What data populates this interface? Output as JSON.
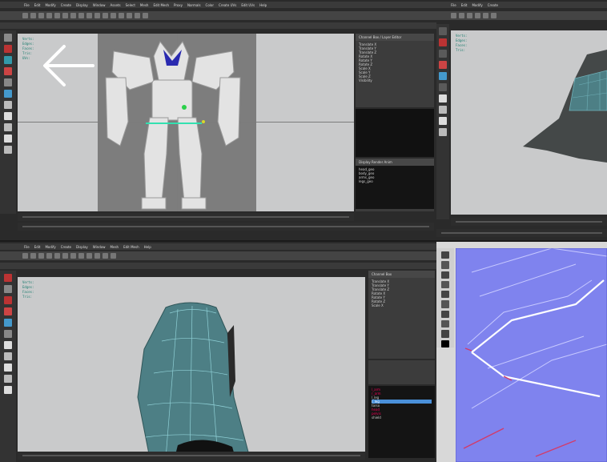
{
  "panes": {
    "top_left": {
      "menu": [
        "File",
        "Edit",
        "Modify",
        "Create",
        "Display",
        "Window",
        "Assets",
        "Select",
        "Mesh",
        "Edit Mesh",
        "Proxy",
        "Normals",
        "Color",
        "Create UVs",
        "Edit UVs",
        "Help"
      ],
      "hud": [
        "Verts:",
        "Edges:",
        "Faces:",
        "Tris:",
        "UVs:"
      ],
      "attr_title": "Channel Box / Layer Editor",
      "attr_rows": [
        "Translate X",
        "Translate Y",
        "Translate Z",
        "Rotate X",
        "Rotate Y",
        "Rotate Z",
        "Scale X",
        "Scale Y",
        "Scale Z",
        "Visibility"
      ],
      "layer_title": "Display   Render   Anim",
      "layer_rows": [
        "head_geo",
        "body_geo",
        "arms_geo",
        "legs_geo"
      ]
    },
    "top_right": {
      "menu": [
        "File",
        "Edit",
        "Modify",
        "Create"
      ],
      "hud": [
        "Verts:",
        "Edges:",
        "Faces:",
        "Tris:"
      ]
    },
    "bottom_left": {
      "menu": [
        "File",
        "Edit",
        "Modify",
        "Create",
        "Display",
        "Window",
        "Mesh",
        "Edit Mesh",
        "Help"
      ],
      "hud": [
        "Verts:",
        "Edges:",
        "Faces:",
        "Tris:"
      ],
      "attr_title": "Channel Box",
      "attr_rows": [
        "Translate X",
        "Translate Y",
        "Translate Z",
        "Rotate X",
        "Rotate Y",
        "Rotate Z",
        "Scale X"
      ],
      "outliner_rows": [
        "l_arm",
        "r_arm",
        "l_leg",
        "r_leg",
        "torso",
        "head",
        "pelvis",
        "shield"
      ]
    },
    "bottom_right": {}
  },
  "colors": {
    "viewport_bg": "#c9cacb",
    "uv_bg": "#7f83ee",
    "mesh_blue": "#4d7f85",
    "hud_text": "#1c7d6f",
    "selection": "#4a90d9"
  }
}
